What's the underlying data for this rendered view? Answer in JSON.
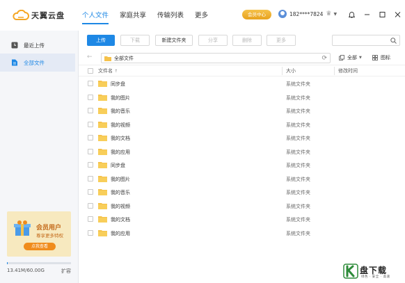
{
  "app": {
    "logo_text": "天翼云盘",
    "brand_color": "#f5a623",
    "accent_color": "#1e88e5"
  },
  "nav": {
    "tabs": [
      {
        "label": "个人文件",
        "active": true
      },
      {
        "label": "家庭共享",
        "active": false
      },
      {
        "label": "传输列表",
        "active": false
      },
      {
        "label": "更多",
        "active": false
      }
    ]
  },
  "header": {
    "vip_label": "会员中心",
    "user_name": "182****7824"
  },
  "sidebar": {
    "items": [
      {
        "label": "最近上传",
        "icon": "clock-icon",
        "active": false
      },
      {
        "label": "全部文件",
        "icon": "folder-list-icon",
        "active": true
      }
    ],
    "promo": {
      "title": "会员用户",
      "subtitle": "尊享更多特权",
      "button": "点我查看"
    },
    "storage": {
      "text": "13.41M/60.00G",
      "used_fraction": 0.0002,
      "expand_label": "扩容"
    }
  },
  "toolbar": {
    "upload": "上传",
    "download": "下载",
    "new_folder": "新建文件夹",
    "share": "分享",
    "delete": "删除",
    "more": "更多",
    "search_placeholder": ""
  },
  "pathbar": {
    "path": "全部文件",
    "filter_label": "全部",
    "view_label": "图标"
  },
  "table": {
    "columns": {
      "name": "文件名",
      "size": "大小",
      "modified": "修改时间"
    },
    "rows": [
      {
        "name": "同步盘",
        "size": "系统文件夹"
      },
      {
        "name": "我的图片",
        "size": "系统文件夹"
      },
      {
        "name": "我的音乐",
        "size": "系统文件夹"
      },
      {
        "name": "我的视频",
        "size": "系统文件夹"
      },
      {
        "name": "我的文档",
        "size": "系统文件夹"
      },
      {
        "name": "我的应用",
        "size": "系统文件夹"
      },
      {
        "name": "同步盘",
        "size": "系统文件夹"
      },
      {
        "name": "我的图片",
        "size": "系统文件夹"
      },
      {
        "name": "我的音乐",
        "size": "系统文件夹"
      },
      {
        "name": "我的视频",
        "size": "系统文件夹"
      },
      {
        "name": "我的文档",
        "size": "系统文件夹"
      },
      {
        "name": "我的应用",
        "size": "系统文件夹"
      }
    ]
  },
  "watermark": {
    "text": "盘下载",
    "subtitle": "绿色 · 安全 · 高速"
  }
}
